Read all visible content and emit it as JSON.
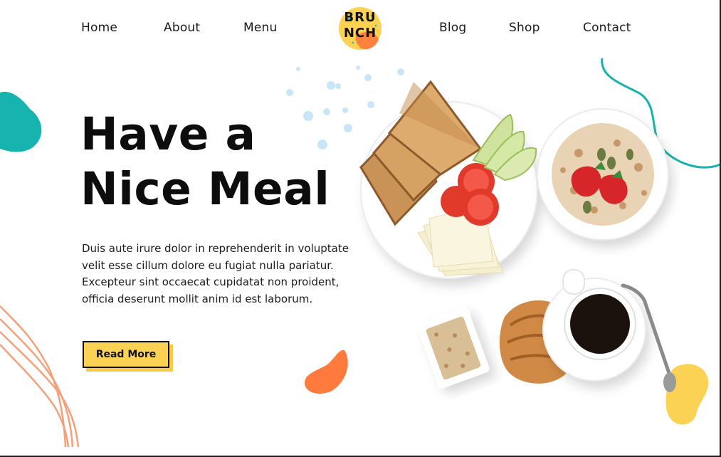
{
  "nav": {
    "left_items": [
      "Home",
      "About",
      "Menu"
    ],
    "right_items": [
      "Blog",
      "Shop",
      "Contact"
    ],
    "logo": {
      "line1": "BRU",
      "line2": "NCH"
    }
  },
  "hero": {
    "headline_line1": "Have a",
    "headline_line2": "Nice Meal",
    "body_lines": [
      "Duis aute irure dolor in reprehenderit in voluptate",
      "velit esse cillum dolore eu fugiat nulla pariatur.",
      "Excepteur sint occaecat cupidatat non proident,",
      "officia deserunt mollit anim id est laborum."
    ],
    "cta_label": "Read More"
  },
  "colors": {
    "teal": "#17b3ae",
    "orange": "#ff7a3c",
    "yellow": "#fcd255",
    "peach": "#f4a07a",
    "light_blue": "#c9e6f8"
  }
}
